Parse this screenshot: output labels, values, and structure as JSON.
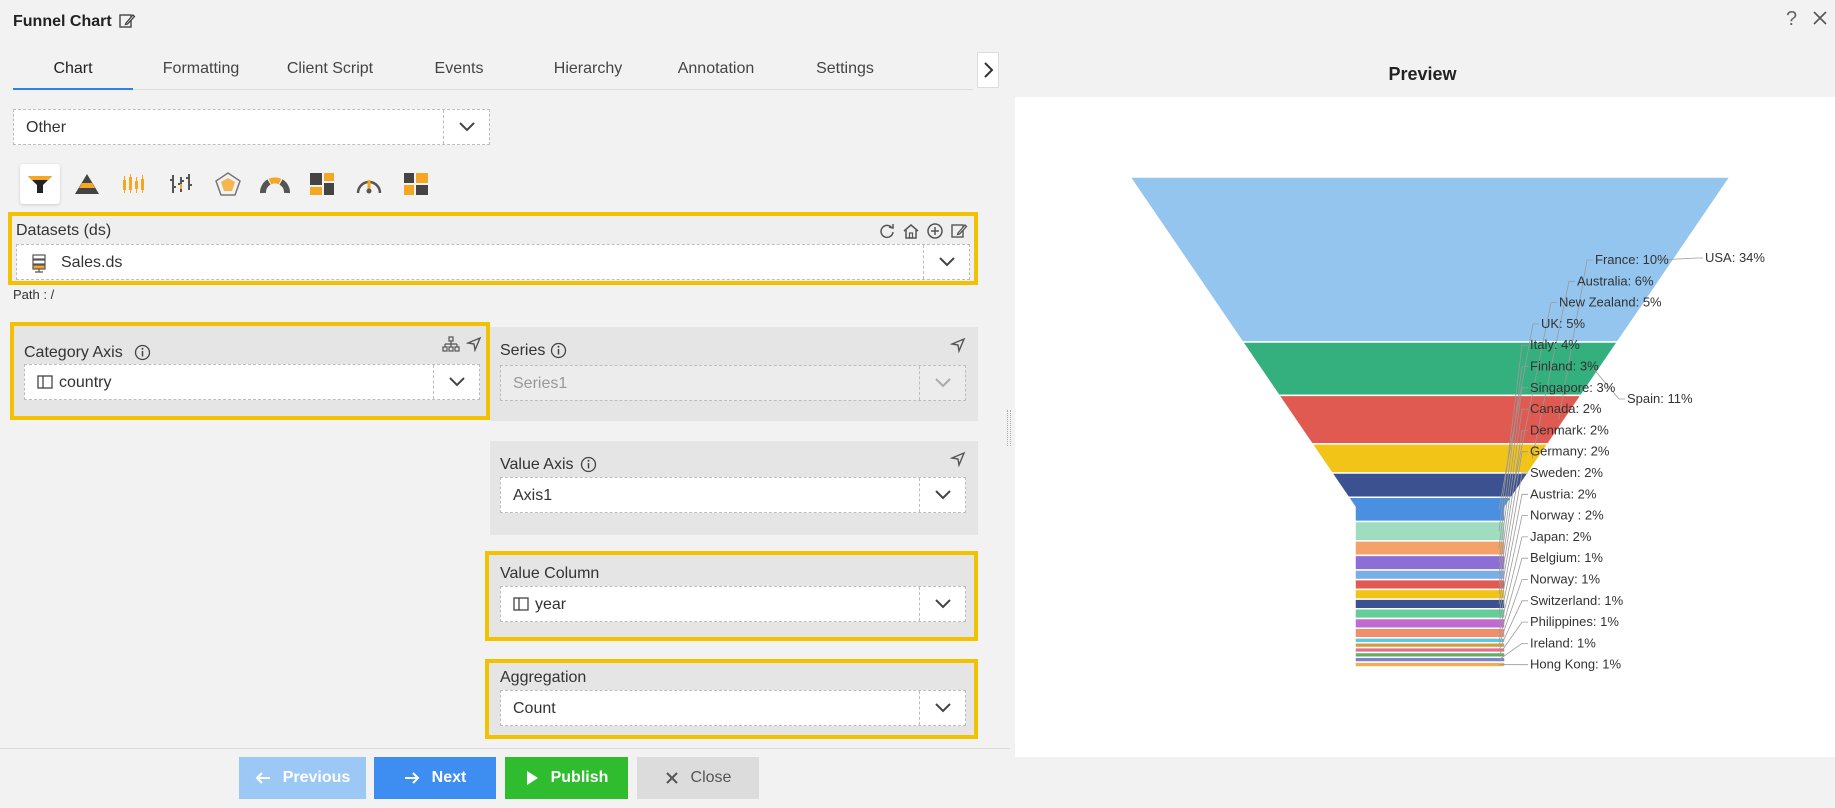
{
  "window": {
    "title": "Funnel Chart",
    "help_label": "?"
  },
  "tabs": [
    "Chart",
    "Formatting",
    "Client Script",
    "Events",
    "Hierarchy",
    "Annotation",
    "Settings"
  ],
  "chart_group": {
    "value": "Other"
  },
  "chart_types": [
    "funnel-icon",
    "pyramid-icon",
    "candlestick-icon",
    "ohlc-icon",
    "radar-icon",
    "gauge-icon",
    "treemap-icon",
    "speedometer-icon",
    "heatmap-icon"
  ],
  "datasets": {
    "label": "Datasets (ds)",
    "value": "Sales.ds",
    "path": "Path : /"
  },
  "category_axis": {
    "label": "Category Axis",
    "value": "country"
  },
  "series": {
    "label": "Series",
    "placeholder": "Series1"
  },
  "value_axis": {
    "label": "Value Axis",
    "value": "Axis1"
  },
  "value_column": {
    "label": "Value Column",
    "value": "year"
  },
  "aggregation": {
    "label": "Aggregation",
    "value": "Count"
  },
  "footer": {
    "previous": "Previous",
    "next": "Next",
    "publish": "Publish",
    "close": "Close"
  },
  "preview": {
    "title": "Preview"
  },
  "colors": {
    "accent": "#2f80ed",
    "highlight": "#f2c200",
    "publish": "#2fbd2f"
  },
  "chart_data": {
    "type": "funnel",
    "title": "",
    "categories": [
      "USA",
      "Spain",
      "France",
      "Australia",
      "New Zealand",
      "UK",
      "Italy",
      "Finland",
      "Singapore",
      "Canada",
      "Denmark",
      "Germany",
      "Sweden",
      "Austria",
      "Norway ",
      "Japan",
      "Belgium",
      "Norway",
      "Switzerland",
      "Philippines",
      "Ireland",
      "Hong Kong"
    ],
    "values": [
      34,
      11,
      10,
      6,
      5,
      5,
      4,
      3,
      3,
      2,
      2,
      2,
      2,
      2,
      2,
      2,
      1,
      1,
      1,
      1,
      1,
      1
    ],
    "labels": [
      "USA: 34%",
      "Spain: 11%",
      "France: 10%",
      "Australia: 6%",
      "New Zealand: 5%",
      "UK: 5%",
      "Italy: 4%",
      "Finland: 3%",
      "Singapore: 3%",
      "Canada: 2%",
      "Denmark: 2%",
      "Germany: 2%",
      "Sweden: 2%",
      "Austria: 2%",
      "Norway : 2%",
      "Japan: 2%",
      "Belgium: 1%",
      "Norway: 1%",
      "Switzerland: 1%",
      "Philippines: 1%",
      "Ireland: 1%",
      "Hong Kong: 1%"
    ],
    "colors": [
      "#93c5ef",
      "#33b07e",
      "#e05a52",
      "#f2c418",
      "#3c5290",
      "#4a8fe0",
      "#9fdcc0",
      "#f4a26a",
      "#8c6fd6",
      "#7aaee8",
      "#e05a52",
      "#f2c418",
      "#3c5290",
      "#66cc99",
      "#c06bd0",
      "#f08f6a",
      "#5ac8e0",
      "#d0a040",
      "#e07090",
      "#60b060",
      "#8080d0",
      "#f0b050"
    ]
  }
}
